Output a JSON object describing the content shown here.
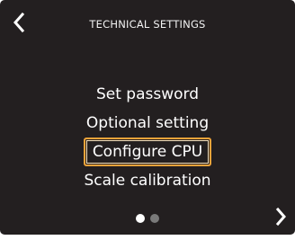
{
  "header": {
    "title": "TECHNICAL SETTINGS"
  },
  "icons": {
    "back": "chevron-left-icon",
    "next": "chevron-right-icon"
  },
  "menu": {
    "items": [
      {
        "label": "Set password",
        "selected": false
      },
      {
        "label": "Optional setting",
        "selected": false
      },
      {
        "label": "Configure CPU",
        "selected": true
      },
      {
        "label": "Scale calibration",
        "selected": false
      }
    ]
  },
  "pager": {
    "pages": 2,
    "current": 1
  },
  "colors": {
    "background": "#231f20",
    "text": "#ffffff",
    "selection": "#f0a43a"
  }
}
